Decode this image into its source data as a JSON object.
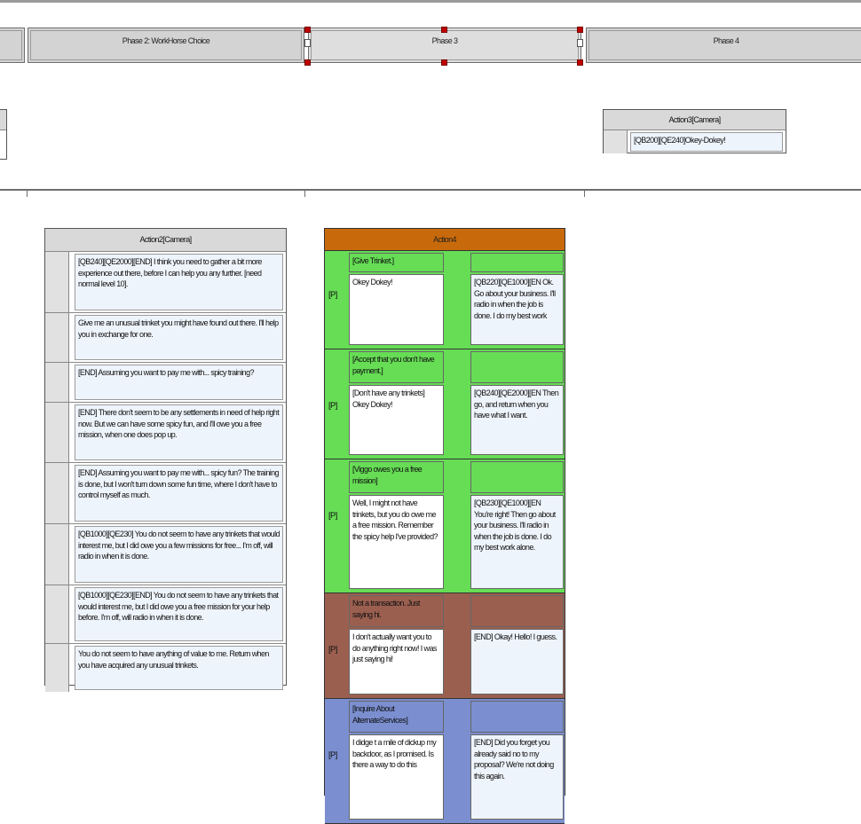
{
  "phases": [
    {
      "label": ""
    },
    {
      "label": "Phase 2: WorkHorse Choice"
    },
    {
      "label": "Phase 3"
    },
    {
      "label": "Phase 4"
    }
  ],
  "action3": {
    "title": "Action3[Camera]",
    "lines": [
      "[QB200][QE240]Okey-Dokey!"
    ]
  },
  "action2": {
    "title": "Action2[Camera]",
    "lines": [
      "[QB240][QE2000][END] I think you need to gather a bit more experience out there, before I can help you any further. [need normal level 10].",
      "Give me an unusual trinket you might have found out there. I'll help you in exchange for one.",
      "[END] Assuming you want to pay me with... spicy training?",
      "[END] There don't seem to be any settlements in need of help right now. But we can have some spicy fun, and I'll owe you a free mission, when one does pop up.",
      "[END] Assuming you want to pay me with... spicy fun? The training is done, but I won't turn down some fun time, where I don't have to control myself as much.",
      "[QB1000][QE230] You do not seem to have any trinkets that would interest me, but I did owe you a few missions for free... I'm off, will radio in when it is done.",
      "[QB1000][QE230][END] You do not seem to have any trinkets that would interest me, but I did owe you a free mission for your help before. I'm off, will radio in when it is done.",
      "You do not seem to have anything of value to me. Return when you have acquired any unusual trinkets."
    ]
  },
  "action4": {
    "title": "Action4",
    "p_label": "[P]",
    "groups": [
      {
        "color": "#66dd55",
        "head": "[Give Trinket.]",
        "left": "Okey Dokey!",
        "right": "[QB220][QE1000][EN Ok. Go about your business. I'll radio in when the job is done. I do my best work"
      },
      {
        "color": "#66dd55",
        "head": "[Accept that you don't have payment.]",
        "left": "[Don't have any trinkets] Okey Dokey!",
        "right": "[QB240][QE2000][EN Then go, and return when you have what I want."
      },
      {
        "color": "#66dd55",
        "head": "[Viggo owes you a free mission]",
        "left": "Well, I might not have trinkets, but you do owe me a free mission. Remember the spicy help I've provided?",
        "right": "[QB230][QE1000][EN You're right! Then go about your business. I'll radio in when the job is done. I do my best work alone."
      },
      {
        "color": "#9b5f50",
        "head": "Not a transaction. Just saying hi.",
        "left": "I don't actually want you to do anything right now! I was just saying hi!",
        "right": "[END] Okay! Hello! I guess."
      },
      {
        "color": "#7b8fd0",
        "head": "[Inquire About AlternateServices]",
        "left": "I didge t a mile of dickup my backdoor, as I promised. Is there a way to do this",
        "right": "[END] Did you forget you already said no to my proposal? We're not doing this again."
      }
    ]
  }
}
